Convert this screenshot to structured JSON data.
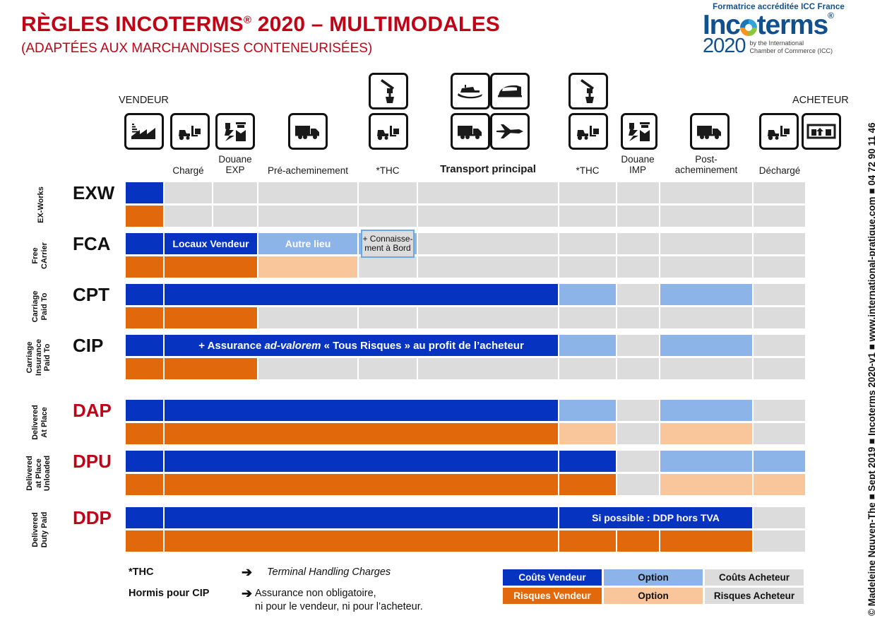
{
  "header": {
    "title_main": "RÈGLES INCOTERMS",
    "title_reg": "®",
    "title_year": " 2020 – ",
    "title_mode": "MULTIMODALES",
    "subtitle": "(ADAPTÉES AUX MARCHANDISES CONTENEURISÉES)"
  },
  "logo": {
    "accreditation": "Formatrice accréditée ICC France",
    "word_pre": "Inc",
    "word_post": "terms",
    "reg": "®",
    "year": "2020",
    "by_line1": "by the International",
    "by_line2": "Chamber of Commerce (ICC)"
  },
  "copyright": "© Madeleine Nguyen-The ■ Sept 2019 ■ Incoterms 2020-v1 ■ www.international-pratique.com ■ 04 72 90 11 46",
  "ends": {
    "seller": "VENDEUR",
    "buyer": "ACHETEUR"
  },
  "columns": [
    {
      "key": "origin",
      "label": "",
      "label2": "",
      "icon": "factory-icon"
    },
    {
      "key": "loaded",
      "label": "Chargé",
      "label2": "",
      "icon": "forklift-icon"
    },
    {
      "key": "cust_exp",
      "label": "Douane",
      "label2": "EXP",
      "icon": "customs-icon"
    },
    {
      "key": "pre_carr",
      "label": "Pré-acheminement",
      "label2": "",
      "icon": "truck-icon"
    },
    {
      "key": "thc_exp",
      "label": "*THC",
      "label2": "",
      "icon": "crane-forklift-icon"
    },
    {
      "key": "main",
      "label": "Transport principal",
      "label2": "",
      "icon": "ship-train-truck-plane-icon"
    },
    {
      "key": "thc_imp",
      "label": "*THC",
      "label2": "",
      "icon": "crane-forklift-icon"
    },
    {
      "key": "cust_imp",
      "label": "Douane",
      "label2": "IMP",
      "icon": "customs-icon"
    },
    {
      "key": "post_carr",
      "label": "Post-",
      "label2": "acheminement",
      "icon": "truck-icon"
    },
    {
      "key": "unloaded",
      "label": "Déchargé",
      "label2": "",
      "icon": "forklift-warehouse-icon"
    }
  ],
  "rows": [
    {
      "code": "EXW",
      "code_color": "black",
      "desc": "EX-Works",
      "costs": [
        "seller",
        "buyer",
        "buyer",
        "buyer",
        "buyer",
        "buyer",
        "buyer",
        "buyer",
        "buyer",
        "buyer"
      ],
      "risks": [
        "risk",
        "buyer",
        "buyer",
        "buyer",
        "buyer",
        "buyer",
        "buyer",
        "buyer",
        "buyer",
        "buyer"
      ]
    },
    {
      "code": "FCA",
      "code_color": "black",
      "desc": "Free\nCArrier",
      "costs": [
        "seller",
        "seller",
        "seller",
        "seller-opt",
        "seller-opt",
        "buyer",
        "buyer",
        "buyer",
        "buyer",
        "buyer"
      ],
      "risks": [
        "risk",
        "risk",
        "risk",
        "risk-opt",
        "buyer",
        "buyer",
        "buyer",
        "buyer",
        "buyer",
        "buyer"
      ]
    },
    {
      "code": "CPT",
      "code_color": "black",
      "desc": "Carriage\nPaid To",
      "costs": [
        "seller",
        "seller",
        "seller",
        "seller",
        "seller",
        "seller",
        "seller-opt",
        "buyer",
        "seller-opt",
        "buyer"
      ],
      "risks": [
        "risk",
        "risk",
        "risk-opt",
        "buyer",
        "buyer",
        "buyer",
        "buyer",
        "buyer",
        "buyer",
        "buyer"
      ]
    },
    {
      "code": "CIP",
      "code_color": "black",
      "desc": "Carriage\nInsurance\nPaid To",
      "costs": [
        "seller",
        "seller",
        "seller",
        "seller",
        "seller",
        "seller",
        "seller-opt",
        "buyer",
        "seller-opt",
        "buyer"
      ],
      "risks": [
        "risk",
        "risk",
        "risk-opt",
        "buyer",
        "buyer",
        "buyer",
        "buyer",
        "buyer",
        "buyer",
        "buyer"
      ]
    },
    {
      "code": "DAP",
      "code_color": "red",
      "desc": "Delivered\nAt Place",
      "costs": [
        "seller",
        "seller",
        "seller",
        "seller",
        "seller",
        "seller",
        "seller-opt",
        "buyer",
        "seller-opt",
        "buyer"
      ],
      "risks": [
        "risk",
        "risk",
        "risk",
        "risk",
        "risk",
        "risk",
        "risk-opt",
        "buyer",
        "risk-opt",
        "buyer"
      ]
    },
    {
      "code": "DPU",
      "code_color": "red",
      "desc": "Delivered\nat Place\nUnloaded",
      "costs": [
        "seller",
        "seller",
        "seller",
        "seller",
        "seller",
        "seller",
        "seller",
        "buyer",
        "seller-opt",
        "seller-opt"
      ],
      "risks": [
        "risk",
        "risk",
        "risk",
        "risk",
        "risk",
        "risk",
        "risk",
        "buyer",
        "risk-opt",
        "risk-opt"
      ]
    },
    {
      "code": "DDP",
      "code_color": "red",
      "desc": "Delivered\nDuty Paid",
      "costs": [
        "seller",
        "seller",
        "seller",
        "seller",
        "seller",
        "seller",
        "seller",
        "seller",
        "seller",
        "buyer"
      ],
      "risks": [
        "risk",
        "risk",
        "risk",
        "risk",
        "risk",
        "risk",
        "risk",
        "risk",
        "risk",
        "buyer"
      ]
    }
  ],
  "cell_labels": {
    "fca_locaux": "Locaux Vendeur",
    "fca_autre": "Autre lieu",
    "fca_callout_l1": "+ Connaisse-",
    "fca_callout_l2": "ment à Bord",
    "cip_insurance_plus": "+  Assurance ",
    "cip_insurance_it": "ad-valorem",
    "cip_insurance_rest": " « Tous Risques » au profit de l’acheteur",
    "ddp_tva": "Si possible : DDP hors TVA"
  },
  "footnotes": [
    {
      "term": "*THC",
      "arrow": "➔",
      "text": "Terminal Handling Charges",
      "italic": true
    },
    {
      "term": "Hormis pour CIP",
      "arrow": "➔",
      "text": "Assurance non obligatoire,",
      "text2": "ni pour le vendeur, ni pour l’acheteur.",
      "italic": false
    }
  ],
  "legend": {
    "row1": [
      "Coûts Vendeur",
      "Option",
      "Coûts Acheteur"
    ],
    "row2": [
      "Risques Vendeur",
      "Option",
      "Risques Acheteur"
    ]
  },
  "colors": {
    "seller": "#0733C1",
    "seller_option": "#8CB4E8",
    "buyer": "#DCDCDC",
    "risk": "#E2690B",
    "risk_option": "#F9C59A",
    "title_red": "#C00418",
    "logo_blue": "#10508F"
  }
}
